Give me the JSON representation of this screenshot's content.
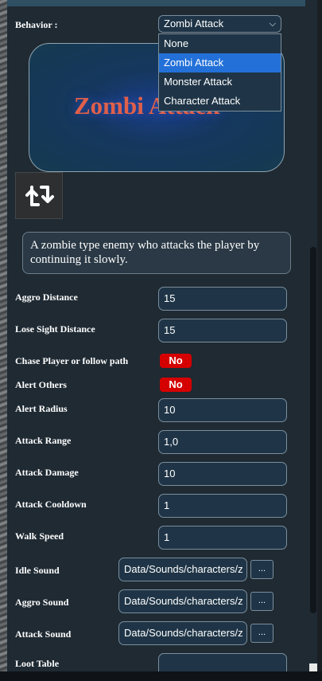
{
  "behavior": {
    "label": "Behavior :",
    "selected": "Zombi Attack",
    "options": [
      "None",
      "Zombi Attack",
      "Monster Attack",
      "Character Attack"
    ]
  },
  "preview": {
    "title": "Zombi Attack"
  },
  "refresh_icon": "refresh-arrows-icon",
  "description": "A zombie type enemy who attacks the player by continuing it slowly.",
  "fields": {
    "aggro_distance": {
      "label": "Aggro Distance",
      "value": "15"
    },
    "lose_sight_distance": {
      "label": "Lose Sight Distance",
      "value": "15"
    },
    "chase_player": {
      "label": "Chase Player or follow path",
      "value": "No"
    },
    "alert_others": {
      "label": "Alert Others",
      "value": "No"
    },
    "alert_radius": {
      "label": "Alert Radius",
      "value": "10"
    },
    "attack_range": {
      "label": "Attack Range",
      "value": "1,0"
    },
    "attack_damage": {
      "label": "Attack Damage",
      "value": "10"
    },
    "attack_cooldown": {
      "label": "Attack Cooldown",
      "value": "1"
    },
    "walk_speed": {
      "label": "Walk Speed",
      "value": "1"
    },
    "idle_sound": {
      "label": "Idle Sound",
      "value": "Data/Sounds/characters/z"
    },
    "aggro_sound": {
      "label": "Aggro Sound",
      "value": "Data/Sounds/characters/z"
    },
    "attack_sound": {
      "label": "Attack Sound",
      "value": "Data/Sounds/characters/z"
    },
    "loot_table": {
      "label": "Loot Table",
      "value": ""
    }
  },
  "browse_label": "...",
  "colors": {
    "toggle_off": "#d50000",
    "selected_option": "#2371d8",
    "field_bg": "#1f3547"
  }
}
